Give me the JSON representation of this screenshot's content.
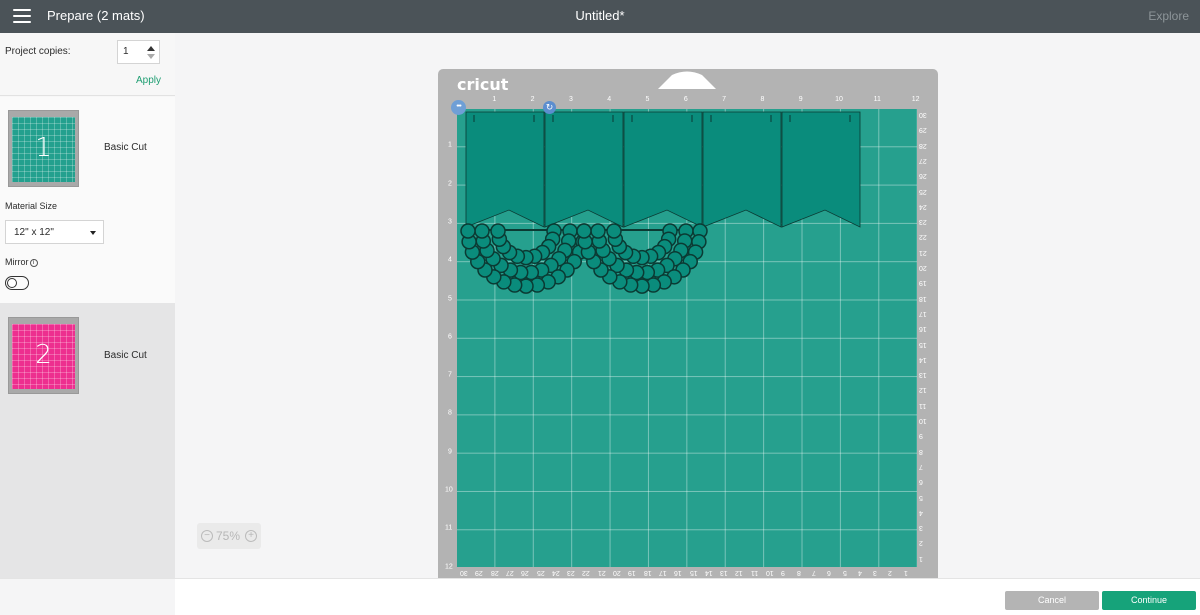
{
  "topbar": {
    "title": "Prepare (2 mats)",
    "project_name": "Untitled*",
    "right_link": "Explore"
  },
  "left_panel": {
    "copies_label": "Project copies:",
    "copies_value": "1",
    "apply_label": "Apply",
    "mats": [
      {
        "number": "1",
        "label": "Basic Cut",
        "color": "#23a08e"
      },
      {
        "number": "2",
        "label": "Basic Cut",
        "color": "#ed2f8f"
      }
    ],
    "material_size_label": "Material Size",
    "material_size_value": "12\" x 12\"",
    "mirror_label": "Mirror",
    "mirror_on": false
  },
  "canvas": {
    "brand": "cricut",
    "mat_color": "#26a08e",
    "shape_color": "#0a8c7c",
    "ruler_top": [
      "1",
      "2",
      "3",
      "4",
      "5",
      "6",
      "7",
      "8",
      "9",
      "10",
      "11",
      "12"
    ],
    "ruler_left": [
      "1",
      "2",
      "3",
      "4",
      "5",
      "6",
      "7",
      "8",
      "9",
      "10",
      "11",
      "12"
    ],
    "ruler_right": [
      "30",
      "29",
      "28",
      "27",
      "26",
      "25",
      "24",
      "23",
      "22",
      "21",
      "20",
      "19",
      "18",
      "17",
      "16",
      "15",
      "14",
      "13",
      "12",
      "11",
      "10",
      "9",
      "8",
      "7",
      "6",
      "5",
      "4",
      "3",
      "2",
      "1"
    ],
    "ruler_bottom": [
      "30",
      "29",
      "28",
      "27",
      "26",
      "25",
      "24",
      "23",
      "22",
      "21",
      "20",
      "19",
      "18",
      "17",
      "16",
      "15",
      "14",
      "13",
      "12",
      "11",
      "10",
      "9",
      "8",
      "7",
      "6",
      "5",
      "4",
      "3",
      "2",
      "1"
    ],
    "zoom_value": "75%",
    "more_icon": "•••",
    "rotate_icon": "↻"
  },
  "bottombar": {
    "cancel_label": "Cancel",
    "continue_label": "Continue"
  }
}
